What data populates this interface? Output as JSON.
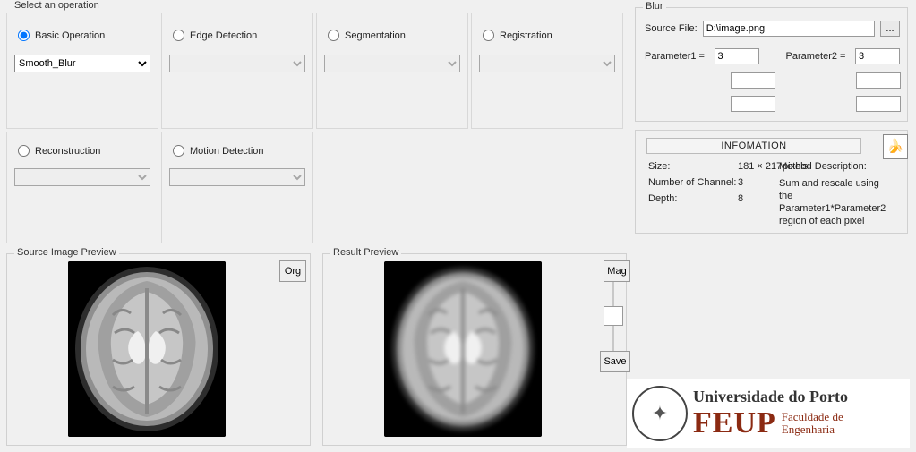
{
  "operations": {
    "title": "Select an operation",
    "cells": {
      "basic": {
        "label": "Basic Operation",
        "selected": true,
        "dropdown_value": "Smooth_Blur",
        "enabled": true
      },
      "edge": {
        "label": "Edge Detection",
        "selected": false,
        "dropdown_value": "",
        "enabled": false
      },
      "seg": {
        "label": "Segmentation",
        "selected": false,
        "dropdown_value": "",
        "enabled": false
      },
      "reg": {
        "label": "Registration",
        "selected": false,
        "dropdown_value": "",
        "enabled": false
      },
      "recon": {
        "label": "Reconstruction",
        "selected": false,
        "dropdown_value": "",
        "enabled": false
      },
      "motion": {
        "label": "Motion Detection",
        "selected": false,
        "dropdown_value": "",
        "enabled": false
      }
    }
  },
  "blur_panel": {
    "title": "Blur",
    "source_file_label": "Source File:",
    "source_file_value": "D:\\image.png",
    "browse_label": "...",
    "param1_label": "Parameter1 =",
    "param1_value": "3",
    "param2_label": "Parameter2 =",
    "param2_value": "3"
  },
  "info_panel": {
    "header": "INFOMATION",
    "size_label": "Size:",
    "size_value": "181 × 217",
    "size_unit": "pixels",
    "channels_label": "Number of Channel:",
    "channels_value": "3",
    "depth_label": "Depth:",
    "depth_value": "8",
    "method_label": "Method Description:",
    "method_value": "Sum and rescale using the Parameter1*Parameter2 region of each pixel"
  },
  "source_preview": {
    "title": "Source Image Preview",
    "org_label": "Org"
  },
  "result_preview": {
    "title": "Result Preview",
    "mag_label": "Mag",
    "save_label": "Save"
  },
  "logo": {
    "line1": "Universidade do Porto",
    "feup": "FEUP",
    "fac": "Faculdade de\nEngenharia"
  }
}
